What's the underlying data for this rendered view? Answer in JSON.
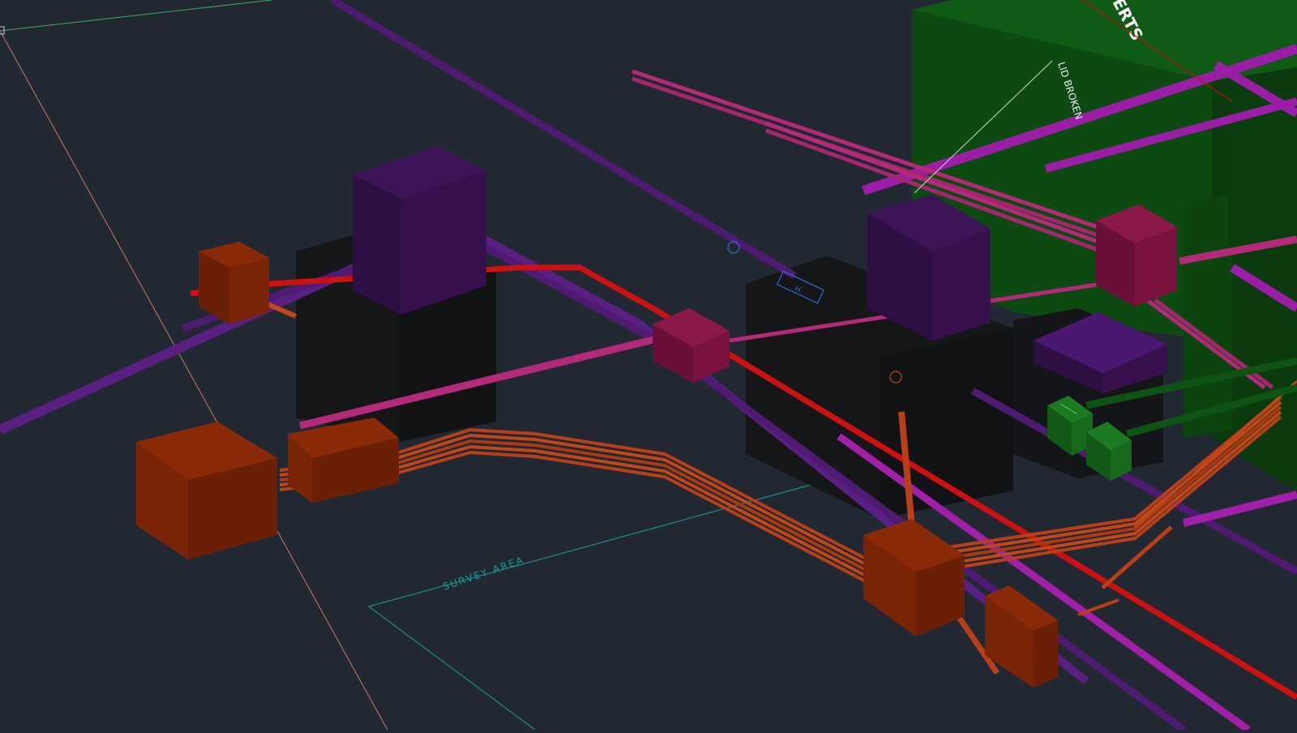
{
  "viewport": {
    "background": "#222831"
  },
  "labels": {
    "survey_area": "SURVEY AREA",
    "lid_broken": "LID BROKEN",
    "header_fragment": "ERTS",
    "small_tag": "H"
  },
  "layer_colors": {
    "electric_ducts": "#c0471a",
    "storm_pipe": "#cc1111",
    "telecom_pipe": "#b22a78",
    "gas_pipe": "#5a1f82",
    "water_pipe": "#a020a8",
    "chambers_dark": "#151618",
    "building": "#0d4a12",
    "survey_boundary": "#1b8a8a"
  }
}
